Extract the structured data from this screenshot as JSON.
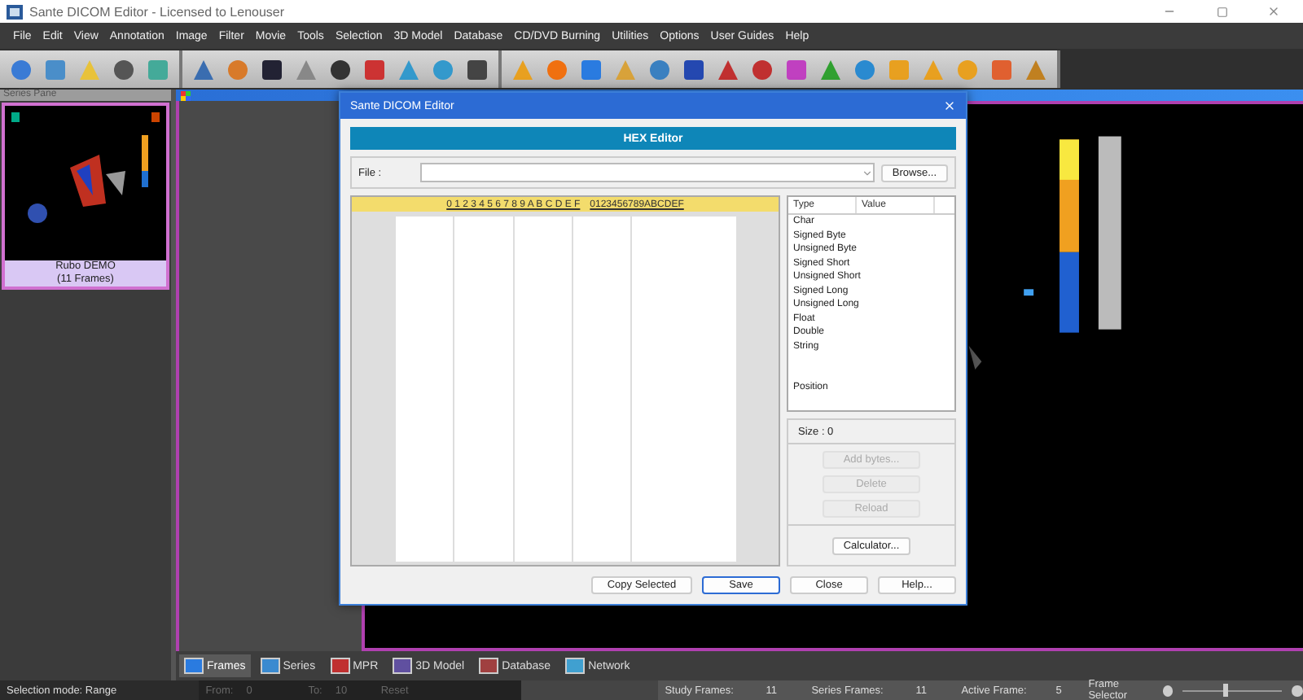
{
  "window": {
    "title": "Sante DICOM Editor - Licensed to Lenouser"
  },
  "menu": [
    "File",
    "Edit",
    "View",
    "Annotation",
    "Image",
    "Filter",
    "Movie",
    "Tools",
    "Selection",
    "3D Model",
    "Database",
    "CD/DVD Burning",
    "Utilities",
    "Options",
    "User Guides",
    "Help"
  ],
  "series_pane": {
    "title": "Series Pane",
    "items": [
      {
        "name": "Rubo DEMO",
        "frames": "(11 Frames)",
        "selected": true
      }
    ]
  },
  "dialog": {
    "title": "Sante DICOM Editor",
    "header": "HEX Editor",
    "file_label": "File :",
    "browse": "Browse...",
    "hex_columns": "0 1 2 3 4 5 6 7 8 9 A B C D E F",
    "ascii_columns": "0123456789ABCDEF",
    "type_table": {
      "columns": [
        "Type",
        "Value"
      ],
      "rows": [
        {
          "type": "Char"
        },
        {
          "type": "Signed Byte"
        },
        {
          "type": "Unsigned Byte"
        },
        {
          "type": "Signed Short"
        },
        {
          "type": "Unsigned Short"
        },
        {
          "type": "Signed Long"
        },
        {
          "type": "Unsigned Long"
        },
        {
          "type": "Float"
        },
        {
          "type": "Double"
        },
        {
          "type": "String"
        },
        {
          "type": "Position",
          "gap": true
        }
      ]
    },
    "size": "Size : 0",
    "side_buttons": [
      {
        "label": "Add bytes...",
        "disabled": true
      },
      {
        "label": "Delete",
        "disabled": true
      },
      {
        "label": "Reload",
        "disabled": true
      }
    ],
    "calculator": "Calculator...",
    "buttons": [
      {
        "label": "Copy Selected",
        "focused": false
      },
      {
        "label": "Save",
        "focused": true
      },
      {
        "label": "Close",
        "focused": false
      },
      {
        "label": "Help...",
        "focused": false
      }
    ]
  },
  "view_tabs": [
    {
      "label": "Frames",
      "selected": true
    },
    {
      "label": "Series",
      "selected": false
    },
    {
      "label": "MPR",
      "selected": false
    },
    {
      "label": "3D Model",
      "selected": false
    },
    {
      "label": "Database",
      "selected": false
    },
    {
      "label": "Network",
      "selected": false
    }
  ],
  "status_bar": {
    "selection_mode": "Selection mode: Range",
    "from_label": "From:",
    "from": "0",
    "to_label": "To:",
    "to": "10",
    "reset": "Reset",
    "study_frames_label": "Study Frames:",
    "study_frames": "11",
    "series_frames_label": "Series Frames:",
    "series_frames": "11",
    "active_frame_label": "Active Frame:",
    "active_frame": "5",
    "frame_selector_label": "Frame Selector",
    "frame_selector": {
      "level": 0.42
    }
  }
}
